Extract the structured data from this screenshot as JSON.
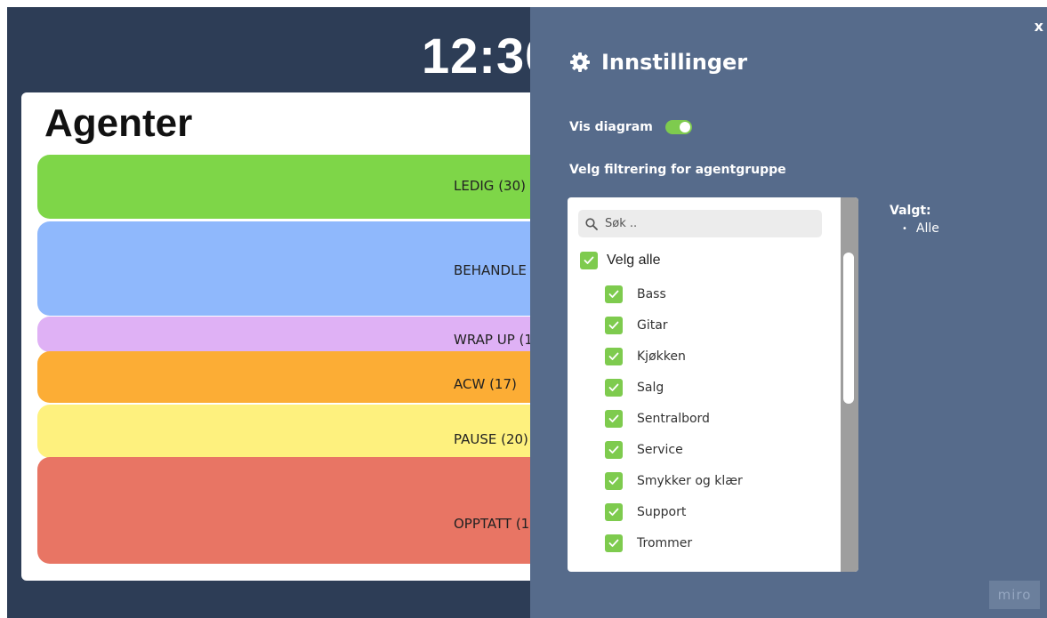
{
  "dashboard": {
    "clock": "12:30",
    "title": "Agenter",
    "statuses": [
      {
        "label": "LEDIG (30)",
        "color": "#7ed648"
      },
      {
        "label": "BEHANDLE",
        "color": "#8fb8fc"
      },
      {
        "label": "WRAP UP (1",
        "color": "#dfb1f5"
      },
      {
        "label": "ACW (17)",
        "color": "#fcad35"
      },
      {
        "label": "PAUSE (20)",
        "color": "#fef17e"
      },
      {
        "label": "OPPTATT (1",
        "color": "#e87564"
      }
    ]
  },
  "settings": {
    "close": "x",
    "title": "Innstillinger",
    "icon": "gear-icon",
    "vis_diagram_label": "Vis diagram",
    "vis_diagram_on": true,
    "filter_label": "Velg filtrering for agentgruppe",
    "search_placeholder": "Søk ..",
    "select_all": "Velg alle",
    "groups": [
      "Bass",
      "Gitar",
      "Kjøkken",
      "Salg",
      "Sentralbord",
      "Service",
      "Smykker og klær",
      "Support",
      "Trommer"
    ],
    "selected_label": "Valgt:",
    "selected_items": [
      "Alle"
    ],
    "accent": "#7ecb4e"
  },
  "watermark": "miro"
}
